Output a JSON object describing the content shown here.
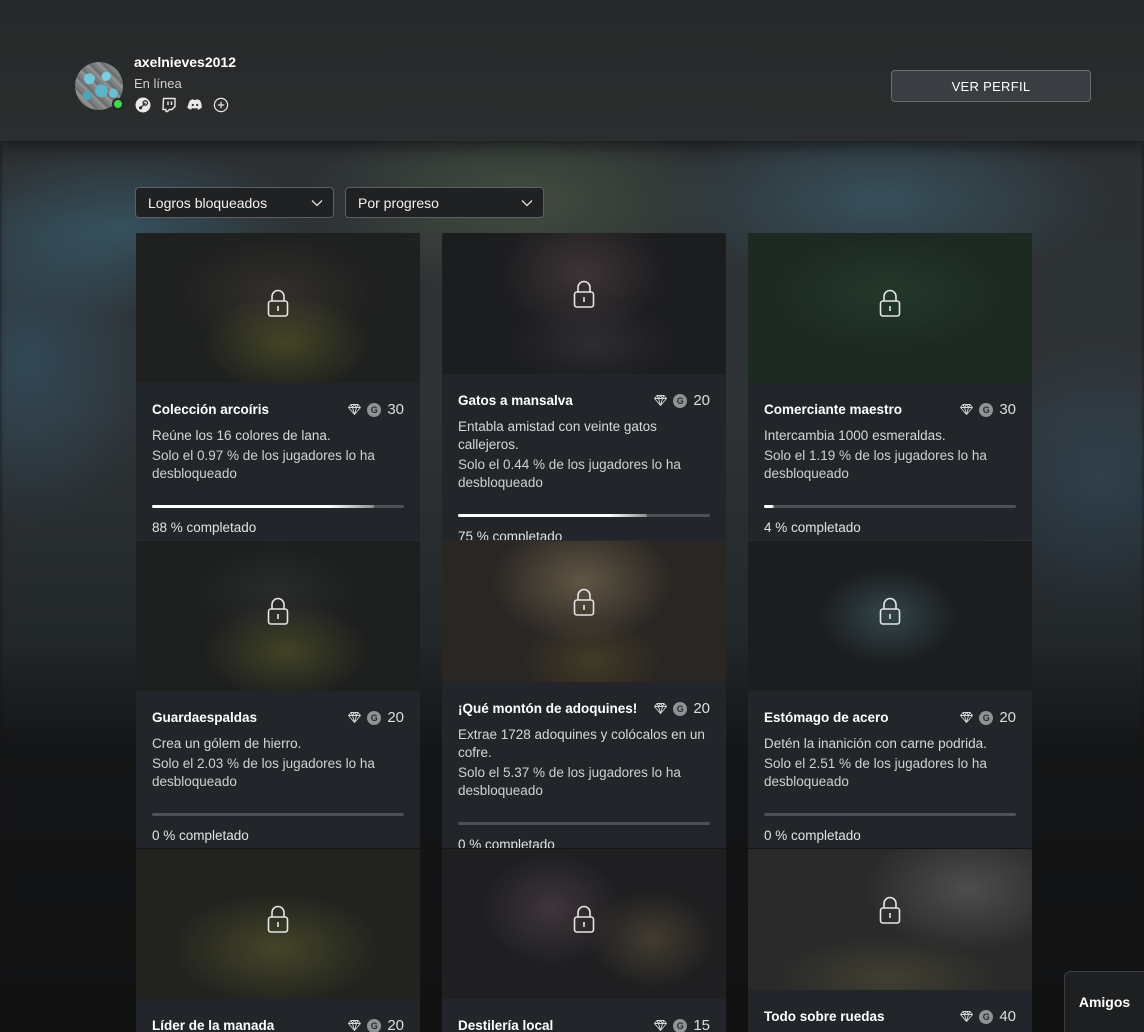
{
  "profile": {
    "username": "axelnieves2012",
    "status": "En línea",
    "view_profile_label": "VER PERFIL",
    "social_icons": [
      "steam-icon",
      "twitch-icon",
      "discord-icon",
      "add-icon"
    ],
    "online_color": "#3fd84b"
  },
  "filters": {
    "lock_filter": "Logros bloqueados",
    "sort_filter": "Por progreso"
  },
  "achievements": [
    {
      "title": "Colección arcoíris",
      "gamerscore": "30",
      "description": "Reúne los 16 colores de lana.",
      "rarity": "Solo el 0.97 % de los jugadores lo ha desbloqueado",
      "progress_label": "88 % completado",
      "progress": 0.88
    },
    {
      "title": "Gatos a mansalva",
      "gamerscore": "20",
      "description": "Entabla amistad con veinte gatos callejeros.",
      "rarity": "Solo el 0.44 % de los jugadores lo ha desbloqueado",
      "progress_label": "75 % completado",
      "progress": 0.75
    },
    {
      "title": "Comerciante maestro",
      "gamerscore": "30",
      "description": "Intercambia 1000 esmeraldas.",
      "rarity": "Solo el 1.19 % de los jugadores lo ha desbloqueado",
      "progress_label": "4 % completado",
      "progress": 0.04
    },
    {
      "title": "Guardaespaldas",
      "gamerscore": "20",
      "description": "Crea un gólem de hierro.",
      "rarity": "Solo el 2.03 % de los jugadores lo ha desbloqueado",
      "progress_label": "0 % completado",
      "progress": 0
    },
    {
      "title": "¡Qué montón de adoquines!",
      "gamerscore": "20",
      "description": "Extrae 1728 adoquines y colócalos en un cofre.",
      "rarity": "Solo el 5.37 % de los jugadores lo ha desbloqueado",
      "progress_label": "0 % completado",
      "progress": 0
    },
    {
      "title": "Estómago de acero",
      "gamerscore": "20",
      "description": "Detén la inanición con carne podrida.",
      "rarity": "Solo el 2.51 % de los jugadores lo ha desbloqueado",
      "progress_label": "0 % completado",
      "progress": 0
    },
    {
      "title": "Líder de la manada",
      "gamerscore": "20"
    },
    {
      "title": "Destilería local",
      "gamerscore": "15"
    },
    {
      "title": "Todo sobre ruedas",
      "gamerscore": "40"
    }
  ],
  "friends_tab_label": "Amigos"
}
